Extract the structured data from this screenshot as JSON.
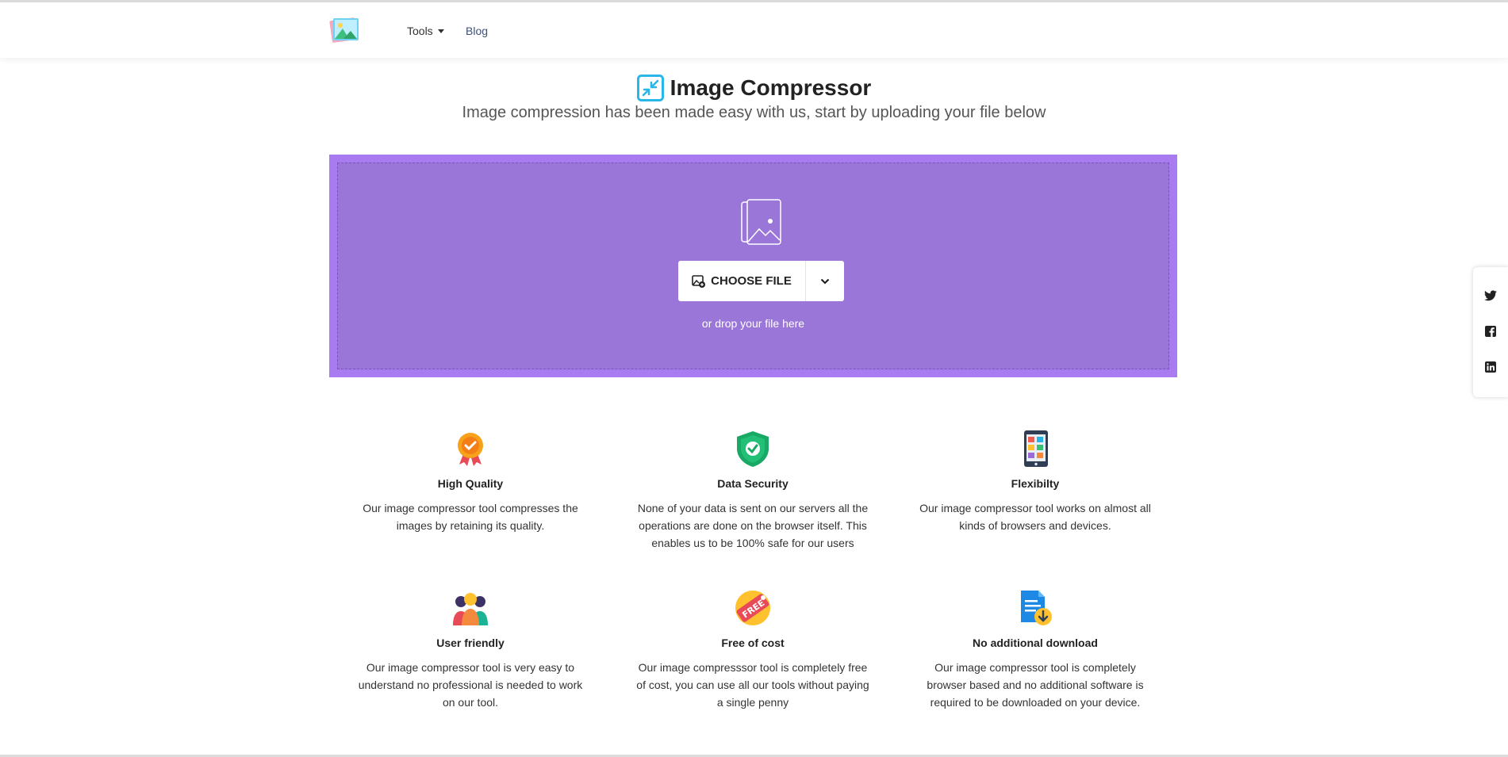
{
  "nav": {
    "logo_icon": "landscape-image-icon",
    "tools_label": "Tools",
    "blog_label": "Blog"
  },
  "hero": {
    "title": "Image Compressor",
    "subtitle": "Image compression has been made easy with us, start by uploading your file below",
    "title_icon": "compress-arrows-icon"
  },
  "upload": {
    "choose_label": "CHOOSE FILE",
    "drop_text": "or drop your file here",
    "background_color": "#9b76d9",
    "border_color": "#a97bf0"
  },
  "features": [
    {
      "icon": "award-medal-icon",
      "title": "High Quality",
      "text": "Our image compressor tool compresses the images by retaining its quality."
    },
    {
      "icon": "shield-check-icon",
      "title": "Data Security",
      "text": "None of your data is sent on our servers all the operations are done on the browser itself. This enables us to be 100% safe for our users"
    },
    {
      "icon": "mobile-device-icon",
      "title": "Flexibilty",
      "text": "Our image compressor tool works on almost all kinds of browsers and devices."
    },
    {
      "icon": "users-group-icon",
      "title": "User friendly",
      "text": "Our image compressor tool is very easy to understand no professional is needed to work on our tool."
    },
    {
      "icon": "free-tag-icon",
      "title": "Free of cost",
      "text": "Our image compresssor tool is completely free of cost, you can use all our tools without paying a single penny"
    },
    {
      "icon": "file-download-icon",
      "title": "No additional download",
      "text": "Our image compressor tool is completely browser based and no additional software is required to be downloaded on your device."
    }
  ],
  "share": [
    "twitter-icon",
    "facebook-icon",
    "linkedin-icon"
  ]
}
